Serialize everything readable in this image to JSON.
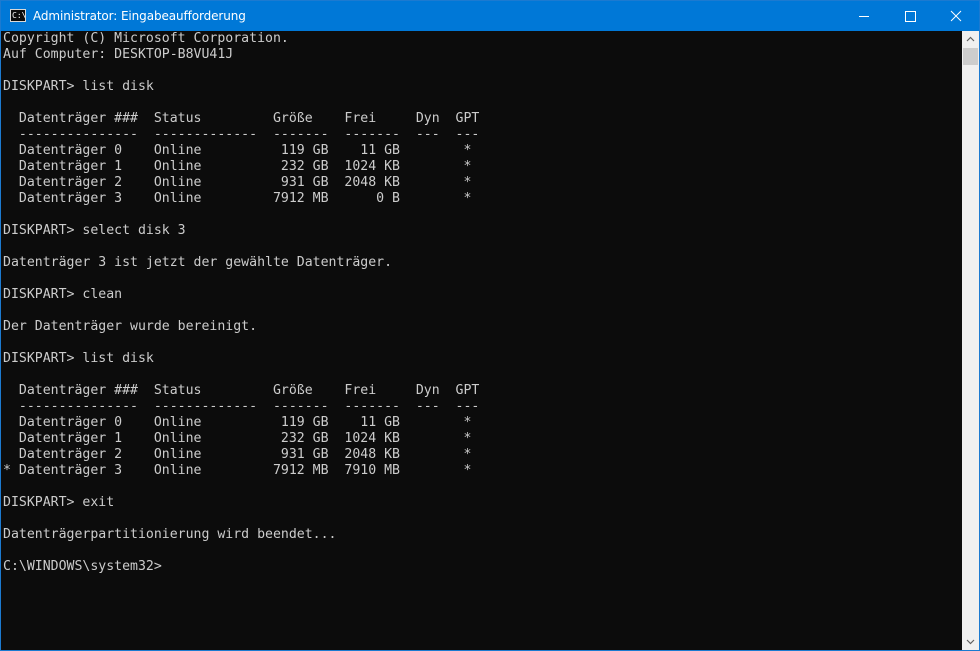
{
  "window": {
    "title": "Administrator: Eingabeaufforderung",
    "icon_text": "C:\\",
    "icon": "cmd-icon",
    "controls": [
      "minimize-icon",
      "maximize-icon",
      "close-icon"
    ]
  },
  "colors": {
    "titlebar": "#0078d7",
    "console_bg": "#0c0c0c",
    "console_fg": "#cccccc"
  },
  "console": {
    "lines": [
      "Copyright (C) Microsoft Corporation.",
      "Auf Computer: DESKTOP-B8VU41J",
      "",
      "DISKPART> list disk",
      "",
      "  Datenträger ###  Status         Größe    Frei     Dyn  GPT",
      "  ---------------  -------------  -------  -------  ---  ---",
      "  Datenträger 0    Online          119 GB    11 GB        *",
      "  Datenträger 1    Online          232 GB  1024 KB        *",
      "  Datenträger 2    Online          931 GB  2048 KB        *",
      "  Datenträger 3    Online         7912 MB      0 B        *",
      "",
      "DISKPART> select disk 3",
      "",
      "Datenträger 3 ist jetzt der gewählte Datenträger.",
      "",
      "DISKPART> clean",
      "",
      "Der Datenträger wurde bereinigt.",
      "",
      "DISKPART> list disk",
      "",
      "  Datenträger ###  Status         Größe    Frei     Dyn  GPT",
      "  ---------------  -------------  -------  -------  ---  ---",
      "  Datenträger 0    Online          119 GB    11 GB        *",
      "  Datenträger 1    Online          232 GB  1024 KB        *",
      "  Datenträger 2    Online          931 GB  2048 KB        *",
      "* Datenträger 3    Online         7912 MB  7910 MB        *",
      "",
      "DISKPART> exit",
      "",
      "Datenträgerpartitionierung wird beendet...",
      "",
      "C:\\WINDOWS\\system32>"
    ]
  }
}
